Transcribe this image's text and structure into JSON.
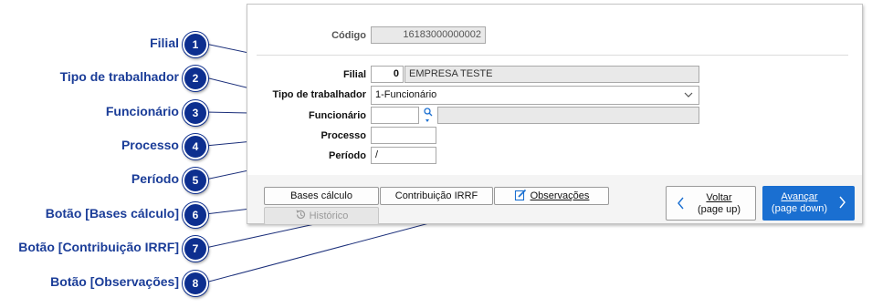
{
  "form": {
    "codigo": {
      "label": "Código",
      "value": "16183000000002"
    },
    "filial": {
      "label": "Filial",
      "code": "0",
      "name": "EMPRESA TESTE"
    },
    "tipo_trabalhador": {
      "label": "Tipo de trabalhador",
      "value": "1-Funcionário"
    },
    "funcionario": {
      "label": "Funcionário",
      "code": "",
      "name": ""
    },
    "processo": {
      "label": "Processo",
      "value": ""
    },
    "periodo": {
      "label": "Período",
      "value": "/"
    }
  },
  "buttons": {
    "bases_calculo": "Bases cálculo",
    "contribuicao_irrf": "Contribuição IRRF",
    "observacoes": "Observações",
    "historico": "Histórico"
  },
  "navigation": {
    "voltar": {
      "label": "Voltar",
      "hint": "(page up)"
    },
    "avancar": {
      "label": "Avançar",
      "hint": "(page down)"
    }
  },
  "callouts": [
    {
      "number": "1",
      "label": "Filial"
    },
    {
      "number": "2",
      "label": "Tipo de trabalhador"
    },
    {
      "number": "3",
      "label": "Funcionário"
    },
    {
      "number": "4",
      "label": "Processo"
    },
    {
      "number": "5",
      "label": "Período"
    },
    {
      "number": "6",
      "label": "Botão [Bases cálculo]"
    },
    {
      "number": "7",
      "label": "Botão [Contribuição IRRF]"
    },
    {
      "number": "8",
      "label": "Botão [Observações]"
    }
  ],
  "colors": {
    "accent": "#1a6fd1",
    "callout": "#0d2f8f",
    "callout_text": "#1b3d98"
  }
}
